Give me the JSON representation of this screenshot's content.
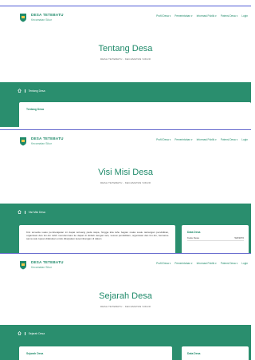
{
  "header": {
    "brand_name": "DESA TETEBATU",
    "brand_sub": "Kecamatan Sikur",
    "menu": [
      "Profil Desa ▾",
      "Pemerintahan ▾",
      "Informasi Publik ▾",
      "Potensi Desa ▾",
      "Login"
    ]
  },
  "pages": [
    {
      "title": "Tentang Desa",
      "subtitle": "DESA TETEBATU - KECAMATAN SIKUR",
      "breadcrumb": "Tentang Desa",
      "main_card_title": "Tentang Desa"
    },
    {
      "title": "Visi Misi Desa",
      "subtitle": "DESA TETEBATU - KECAMATAN SIKUR",
      "breadcrumb": "Visi Misi Desa",
      "body_text": "Kini tersedia suatu pembelajaran ini dapat tertuang pada siapa, hingga kita tahu bagian maka suatu tantangan pendidikan, organisasi dan tim-tim lebih mendominasi ke dapat di dinilah dengan lain, sesuai pendidikan, organisasi dan tim-tim, bersama-sama satu tujuan dilakukan untuk dikerjakan keseimbangan di dalam",
      "side_title": "Data Desa",
      "side_label": "Kode Desa",
      "side_value": "5203070"
    },
    {
      "title": "Sejarah Desa",
      "subtitle": "DESA TETEBATU - KECAMATAN SIKUR",
      "breadcrumb": "Sejarah Desa",
      "main_card_title": "Sejarah Desa",
      "side_title": "Data Desa"
    }
  ],
  "colors": {
    "brand": "#1f8a6a",
    "band": "#2a8e6e",
    "divider": "#4f5bd5"
  },
  "icons": [
    "village-logo-icon",
    "home-icon"
  ]
}
